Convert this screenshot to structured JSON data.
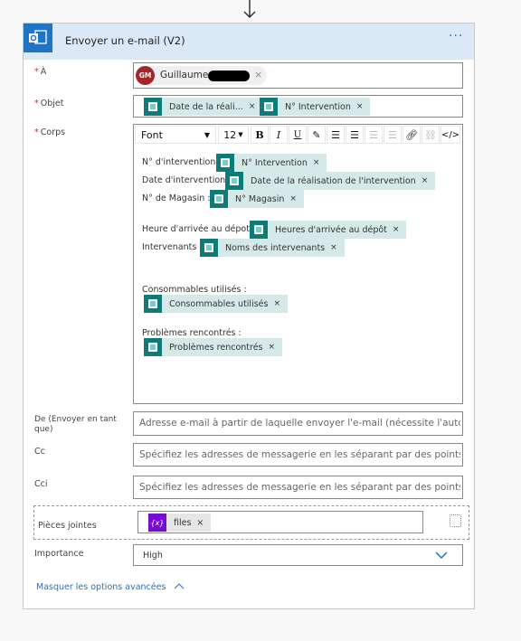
{
  "header": {
    "title": "Envoyer un e-mail (V2)",
    "more": "···",
    "icon": "outlook-icon"
  },
  "to": {
    "label": "À",
    "required": "*",
    "recipient": {
      "initials": "GM",
      "name": "Guillaume",
      "avatar_color": "#a4262c"
    }
  },
  "subject": {
    "label": "Objet",
    "required": "*",
    "tokens": [
      "Date de la réali...",
      "N° Intervention"
    ]
  },
  "body": {
    "label": "Corps",
    "required": "*",
    "toolbar": {
      "font": "Font",
      "size": "12",
      "bold": "B",
      "italic": "I",
      "underline": "U",
      "code": "</>"
    },
    "lines": [
      {
        "text": "N° d'intervention :",
        "token": "N° Intervention"
      },
      {
        "text": "Date d'intervention :",
        "token": "Date de la réalisation de l'intervention"
      },
      {
        "text": "N° de Magasin :",
        "token": "N° Magasin"
      },
      {
        "text": "Heure d'arrivée au dépot :",
        "token": "Heures d'arrivée au dépôt"
      },
      {
        "text": "Intervenants :",
        "token": "Noms des intervenants"
      },
      {
        "text": "Consommables utilisés :",
        "token": "Consommables utilisés"
      },
      {
        "text": "Problèmes rencontrés :",
        "token": "Problèmes rencontrés"
      }
    ]
  },
  "from": {
    "label": "De (Envoyer en tant que)",
    "placeholder": "Adresse e-mail à partir de laquelle envoyer l'e-mail (nécessite l'autori"
  },
  "cc": {
    "label": "Cc",
    "placeholder": "Spécifiez les adresses de messagerie en les séparant par des points-v"
  },
  "bcc": {
    "label": "Cci",
    "placeholder": "Spécifiez les adresses de messagerie en les séparant par des points-v"
  },
  "attachments": {
    "label": "Pièces jointes",
    "token": "files",
    "token_icon": "{x}",
    "token_color": "#770bd6"
  },
  "importance": {
    "label": "Importance",
    "value": "High"
  },
  "advanced_link": "Masquer les options avancées",
  "close_glyph": "×"
}
